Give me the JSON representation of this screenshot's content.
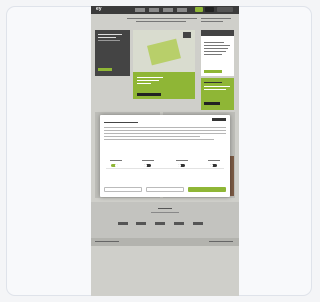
{
  "site": {
    "logo": "ey",
    "headline": "",
    "colors": {
      "accent": "#8fb636",
      "dark": "#3b3b3b",
      "background": "#cfcfca"
    }
  },
  "cookie": {
    "title": "",
    "categories": [
      "",
      "",
      "",
      ""
    ],
    "toggles": [
      true,
      false,
      false,
      false
    ],
    "buttons": [
      "",
      "",
      ""
    ]
  },
  "footer": {
    "heading": ""
  }
}
